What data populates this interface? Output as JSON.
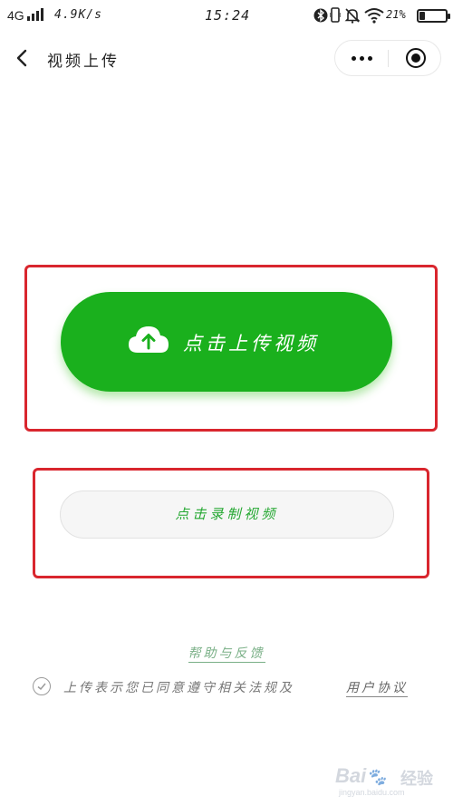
{
  "status_bar": {
    "network": "4G",
    "speed": "4.9K/s",
    "time": "15:24",
    "battery_percent": "21%",
    "battery_level": 0.21
  },
  "nav": {
    "title": "视频上传"
  },
  "upload": {
    "label": "点击上传视频",
    "icon": "cloud-upload-icon",
    "color": "#1ab01d"
  },
  "record": {
    "label": "点击录制视频",
    "color": "#25a832"
  },
  "help": {
    "label": "帮助与反馈"
  },
  "agreement": {
    "text": "上传表示您已同意遵守相关法规及",
    "link": "用户协议"
  },
  "watermark": {
    "logo": "Baidu 经验",
    "url": "jingyan.baidu.com"
  },
  "highlight_color": "#d9262e"
}
